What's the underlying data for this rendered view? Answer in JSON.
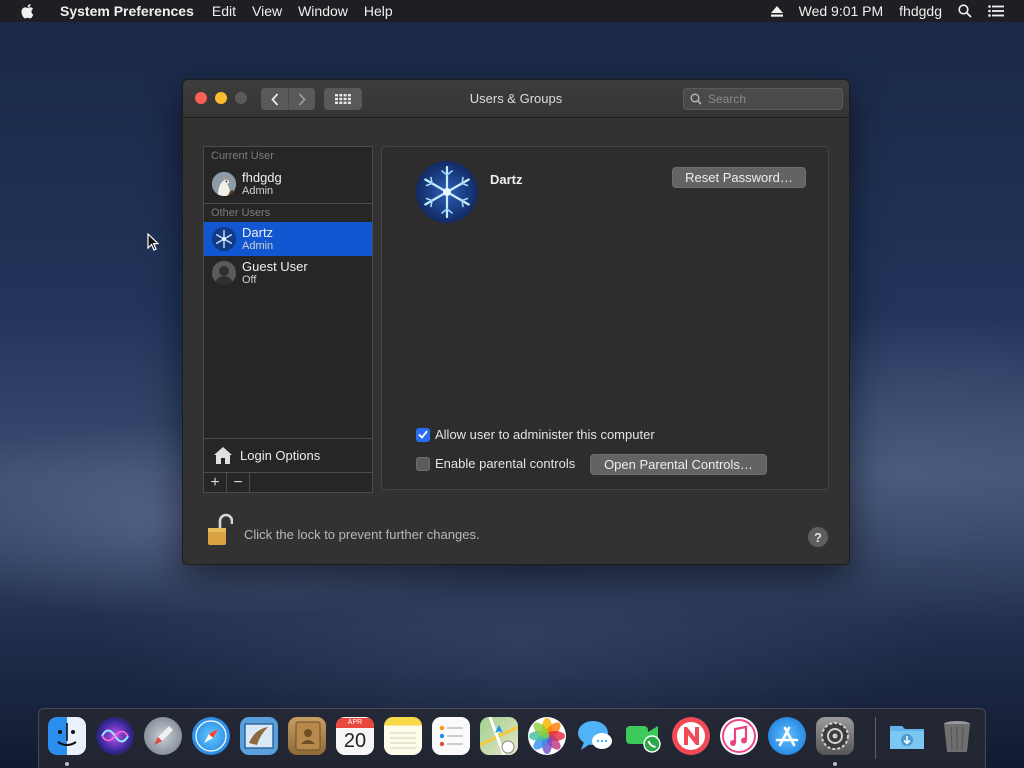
{
  "menubar": {
    "app_name": "System Preferences",
    "menus": [
      "Edit",
      "View",
      "Window",
      "Help"
    ],
    "clock": "Wed 9:01 PM",
    "username": "fhdgdg"
  },
  "window": {
    "title": "Users & Groups",
    "search_placeholder": "Search"
  },
  "sidebar": {
    "current_header": "Current User",
    "other_header": "Other Users",
    "current_user": {
      "name": "fhdgdg",
      "role": "Admin"
    },
    "other_users": [
      {
        "name": "Dartz",
        "role": "Admin",
        "selected": true
      },
      {
        "name": "Guest User",
        "role": "Off",
        "selected": false
      }
    ],
    "login_options": "Login Options",
    "add_label": "+",
    "remove_label": "−"
  },
  "detail": {
    "user_name": "Dartz",
    "reset_password": "Reset Password…",
    "allow_admin": {
      "label": "Allow user to administer this computer",
      "checked": true
    },
    "parental_controls": {
      "label": "Enable parental controls",
      "checked": false
    },
    "open_parental": "Open Parental Controls…"
  },
  "footer": {
    "lock_text": "Click the lock to prevent further changes.",
    "help": "?"
  },
  "dock": {
    "calendar_month": "APR",
    "calendar_day": "20",
    "apps": [
      {
        "name": "finder-icon",
        "color": "#2a8ef0",
        "running": true
      },
      {
        "name": "siri-icon",
        "color": "#6a3fd0",
        "running": false
      },
      {
        "name": "launchpad-icon",
        "color": "#9aa3ad",
        "running": false
      },
      {
        "name": "safari-icon",
        "color": "#1d9bf0",
        "running": false
      },
      {
        "name": "mail-icon",
        "color": "#6aa7e0",
        "running": false
      },
      {
        "name": "contacts-icon",
        "color": "#b68a52",
        "running": false
      },
      {
        "name": "calendar-icon",
        "color": "#f4f4f4",
        "running": false
      },
      {
        "name": "notes-icon",
        "color": "#f7df6a",
        "running": false
      },
      {
        "name": "reminders-icon",
        "color": "#f6f6f6",
        "running": false
      },
      {
        "name": "maps-icon",
        "color": "#7fc07a",
        "running": false
      },
      {
        "name": "photos-icon",
        "color": "#ffffff",
        "running": false
      },
      {
        "name": "messages-icon",
        "color": "#39a0f5",
        "running": false
      },
      {
        "name": "facetime-icon",
        "color": "#3ccb5a",
        "running": false
      },
      {
        "name": "news-icon",
        "color": "#f2f2f2",
        "running": false
      },
      {
        "name": "itunes-icon",
        "color": "#f2f2f2",
        "running": false
      },
      {
        "name": "app-store-icon",
        "color": "#1e8ff0",
        "running": false
      },
      {
        "name": "system-preferences-icon",
        "color": "#8d8d8d",
        "running": true
      },
      {
        "name": "downloads-folder-icon",
        "color": "#5fb4ea",
        "running": false
      },
      {
        "name": "trash-icon",
        "color": "#7c7c7c",
        "running": false
      }
    ]
  }
}
